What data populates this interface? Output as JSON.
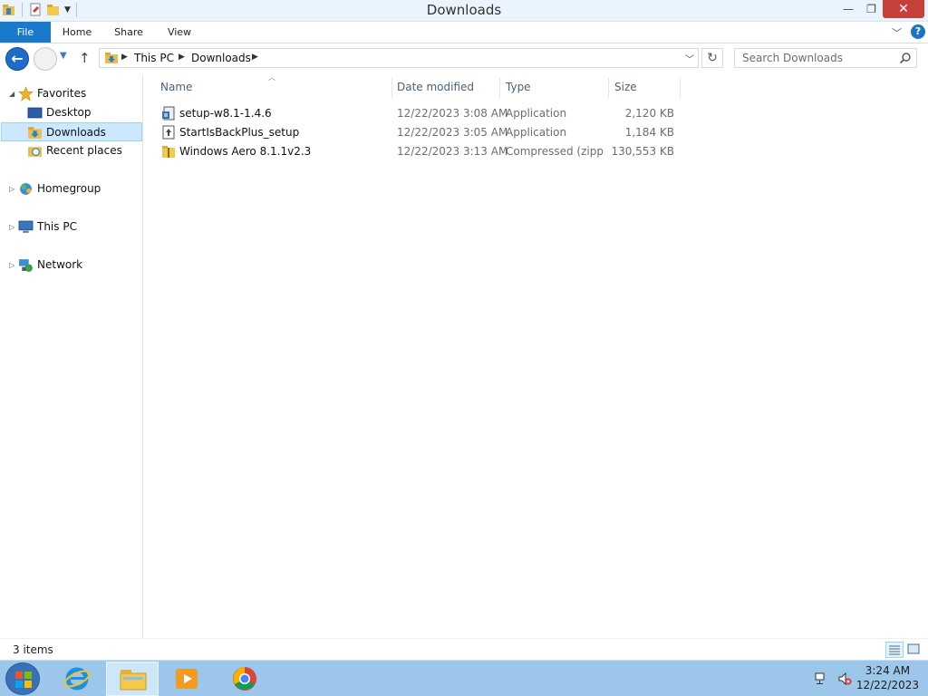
{
  "window": {
    "title": "Downloads"
  },
  "ribbon": {
    "tabs": [
      "File",
      "Home",
      "Share",
      "View"
    ]
  },
  "address": {
    "crumbs": [
      "This PC",
      "Downloads"
    ]
  },
  "search": {
    "placeholder": "Search Downloads"
  },
  "navpane": {
    "favorites": "Favorites",
    "desktop": "Desktop",
    "downloads": "Downloads",
    "recent": "Recent places",
    "homegroup": "Homegroup",
    "thispc": "This PC",
    "network": "Network"
  },
  "columns": {
    "name": "Name",
    "date": "Date modified",
    "type": "Type",
    "size": "Size"
  },
  "files": [
    {
      "name": "setup-w8.1-1.4.6",
      "date": "12/22/2023 3:08 AM",
      "type": "Application",
      "size": "2,120 KB",
      "icon": "setup-exe-icon"
    },
    {
      "name": "StartIsBackPlus_setup",
      "date": "12/22/2023 3:05 AM",
      "type": "Application",
      "size": "1,184 KB",
      "icon": "installer-exe-icon"
    },
    {
      "name": "Windows Aero 8.1.1v2.3",
      "date": "12/22/2023 3:13 AM",
      "type": "Compressed (zipp...",
      "size": "130,553 KB",
      "icon": "zip-folder-icon"
    }
  ],
  "status": {
    "count": "3 items"
  },
  "taskbar": {
    "time": "3:24 AM",
    "date": "12/22/2023"
  },
  "colors": {
    "file_tab": "#1979ca",
    "selection": "#cce8ff",
    "taskbar": "#9cc6ea",
    "close": "#c7413b"
  }
}
